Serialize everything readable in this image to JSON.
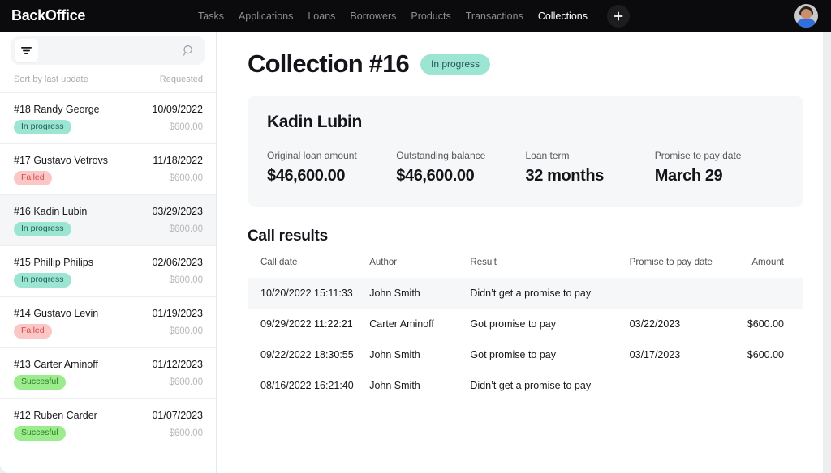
{
  "topbar": {
    "brand": "BackOffice",
    "nav": [
      {
        "label": "Tasks",
        "active": false
      },
      {
        "label": "Applications",
        "active": false
      },
      {
        "label": "Loans",
        "active": false
      },
      {
        "label": "Borrowers",
        "active": false
      },
      {
        "label": "Products",
        "active": false
      },
      {
        "label": "Transactions",
        "active": false
      },
      {
        "label": "Collections",
        "active": true
      }
    ],
    "add_button_icon": "plus-icon",
    "avatar_icon": "user-avatar"
  },
  "sidebar": {
    "filter_icon": "filter-icon",
    "search_icon": "search-icon",
    "search_value": "",
    "search_placeholder": "",
    "sort_label": "Sort by last update",
    "sort_right": "Requested",
    "items": [
      {
        "name": "#18 Randy George",
        "date": "10/09/2022",
        "status": "In progress",
        "status_kind": "inprogress",
        "amount": "$600.00",
        "selected": false
      },
      {
        "name": "#17 Gustavo Vetrovs",
        "date": "11/18/2022",
        "status": "Failed",
        "status_kind": "failed",
        "amount": "$600.00",
        "selected": false
      },
      {
        "name": "#16 Kadin Lubin",
        "date": "03/29/2023",
        "status": "In progress",
        "status_kind": "inprogress",
        "amount": "$600.00",
        "selected": true
      },
      {
        "name": "#15 Phillip Philips",
        "date": "02/06/2023",
        "status": "In progress",
        "status_kind": "inprogress",
        "amount": "$600.00",
        "selected": false
      },
      {
        "name": "#14 Gustavo Levin",
        "date": "01/19/2023",
        "status": "Failed",
        "status_kind": "failed",
        "amount": "$600.00",
        "selected": false
      },
      {
        "name": "#13 Carter Aminoff",
        "date": "01/12/2023",
        "status": "Succesful",
        "status_kind": "successful",
        "amount": "$600.00",
        "selected": false
      },
      {
        "name": "#12 Ruben Carder",
        "date": "01/07/2023",
        "status": "Succesful",
        "status_kind": "successful",
        "amount": "$600.00",
        "selected": false
      }
    ]
  },
  "main": {
    "page_title": "Collection #16",
    "page_status": "In progress",
    "summary": {
      "borrower_name": "Kadin Lubin",
      "stats": [
        {
          "label": "Original loan amount",
          "value": "$46,600.00"
        },
        {
          "label": "Outstanding balance",
          "value": "$46,600.00"
        },
        {
          "label": "Loan term",
          "value": "32 months"
        },
        {
          "label": "Promise to pay date",
          "value": "March 29"
        }
      ]
    },
    "calls": {
      "title": "Call results",
      "columns": [
        "Call date",
        "Author",
        "Result",
        "Promise to pay date",
        "Amount"
      ],
      "rows": [
        {
          "date": "10/20/2022 15:11:33",
          "author": "John Smith",
          "result": "Didn’t get a promise to pay",
          "promise": "",
          "amount": "",
          "highlight": true
        },
        {
          "date": "09/29/2022 11:22:21",
          "author": "Carter Aminoff",
          "result": "Got promise to pay",
          "promise": "03/22/2023",
          "amount": "$600.00",
          "highlight": false
        },
        {
          "date": "09/22/2022 18:30:55",
          "author": "John Smith",
          "result": "Got promise to pay",
          "promise": "03/17/2023",
          "amount": "$600.00",
          "highlight": false
        },
        {
          "date": "08/16/2022 16:21:40",
          "author": "John Smith",
          "result": "Didn’t get a promise to pay",
          "promise": "",
          "amount": "",
          "highlight": false
        }
      ]
    }
  },
  "colors": {
    "topbar_bg": "#0b0b0d",
    "accent_mint": "#9ce5d2",
    "accent_pink": "#fbc7c6",
    "accent_green": "#9bec8d",
    "card_bg": "#f6f7f8"
  }
}
